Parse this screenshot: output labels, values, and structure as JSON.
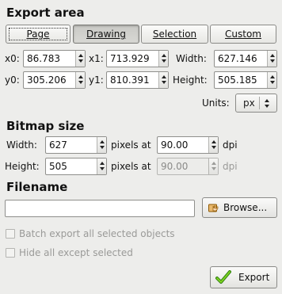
{
  "export_area": {
    "heading": "Export area",
    "tabs": [
      {
        "label": "Page",
        "active": false
      },
      {
        "label": "Drawing",
        "active": true
      },
      {
        "label": "Selection",
        "active": false
      },
      {
        "label": "Custom",
        "active": false
      }
    ],
    "x0_label": "x0:",
    "x0_value": "86.783",
    "x1_label": "x1:",
    "x1_value": "713.929",
    "width_label": "Width:",
    "width_value": "627.146",
    "y0_label": "y0:",
    "y0_value": "305.206",
    "y1_label": "y1:",
    "y1_value": "810.391",
    "height_label": "Height:",
    "height_value": "505.185",
    "units_label": "Units:",
    "units_value": "px"
  },
  "bitmap_size": {
    "heading": "Bitmap size",
    "width_label": "Width:",
    "width_value": "627",
    "pixels_at_1": "pixels at",
    "dpi_x_value": "90.00",
    "dpi_1": "dpi",
    "height_label": "Height:",
    "height_value": "505",
    "pixels_at_2": "pixels at",
    "dpi_y_value": "90.00",
    "dpi_2": "dpi"
  },
  "filename": {
    "heading": "Filename",
    "value": "",
    "browse_label": "Browse..."
  },
  "options": {
    "batch_label": "Batch export all selected objects",
    "batch_checked": false,
    "hide_label": "Hide all except selected",
    "hide_checked": false
  },
  "export_button": {
    "label": "Export"
  },
  "colors": {
    "background": "#ededeb",
    "disabled_text": "#9a9a98",
    "export_check": "#4caf1e"
  }
}
